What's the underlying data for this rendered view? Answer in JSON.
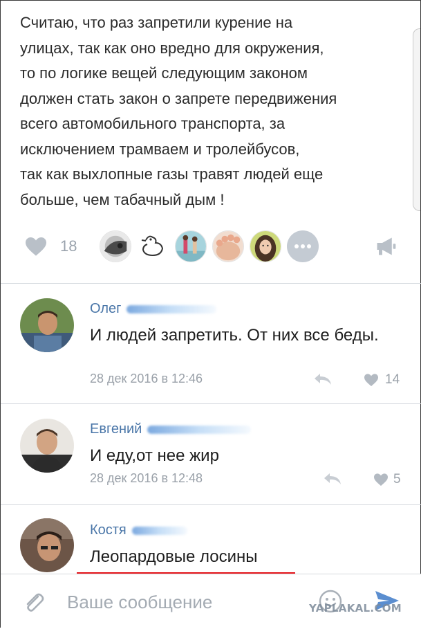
{
  "post": {
    "text": "Считаю, что раз запретили курение на\nулицах, так как оно вредно для окружения,\nто по логике вещей следующим законом\nдолжен стать закон о запрете передвижения\nвсего автомобильного транспорта, за\nисключением трамваем и тролейбусов,\nтак как выхлопные газы травят людей еще\nбольше, чем табачный дым !",
    "like_count": "18",
    "like_icon": "heart-icon",
    "more_likers_icon": "ellipsis-icon",
    "share_icon": "megaphone-icon"
  },
  "comments": [
    {
      "author": "Олег",
      "text": "И людей запретить. От них все беды.",
      "date": "28 дек 2016 в 12:46",
      "likes": "14"
    },
    {
      "author": "Евгений",
      "text": "И еду,от нее жир",
      "date": "28 дек 2016 в 12:48",
      "likes": "5"
    },
    {
      "author": "Костя",
      "text": "Леопардовые лосины"
    }
  ],
  "composer": {
    "placeholder": "Ваше сообщение",
    "attach_icon": "paperclip-icon",
    "emoji_icon": "smile-icon",
    "send_icon": "send-icon"
  },
  "watermark": "YAPLAKAL.COM",
  "colors": {
    "link": "#4a76a8",
    "muted": "#9aa1a9",
    "highlight": "#e5151a"
  }
}
